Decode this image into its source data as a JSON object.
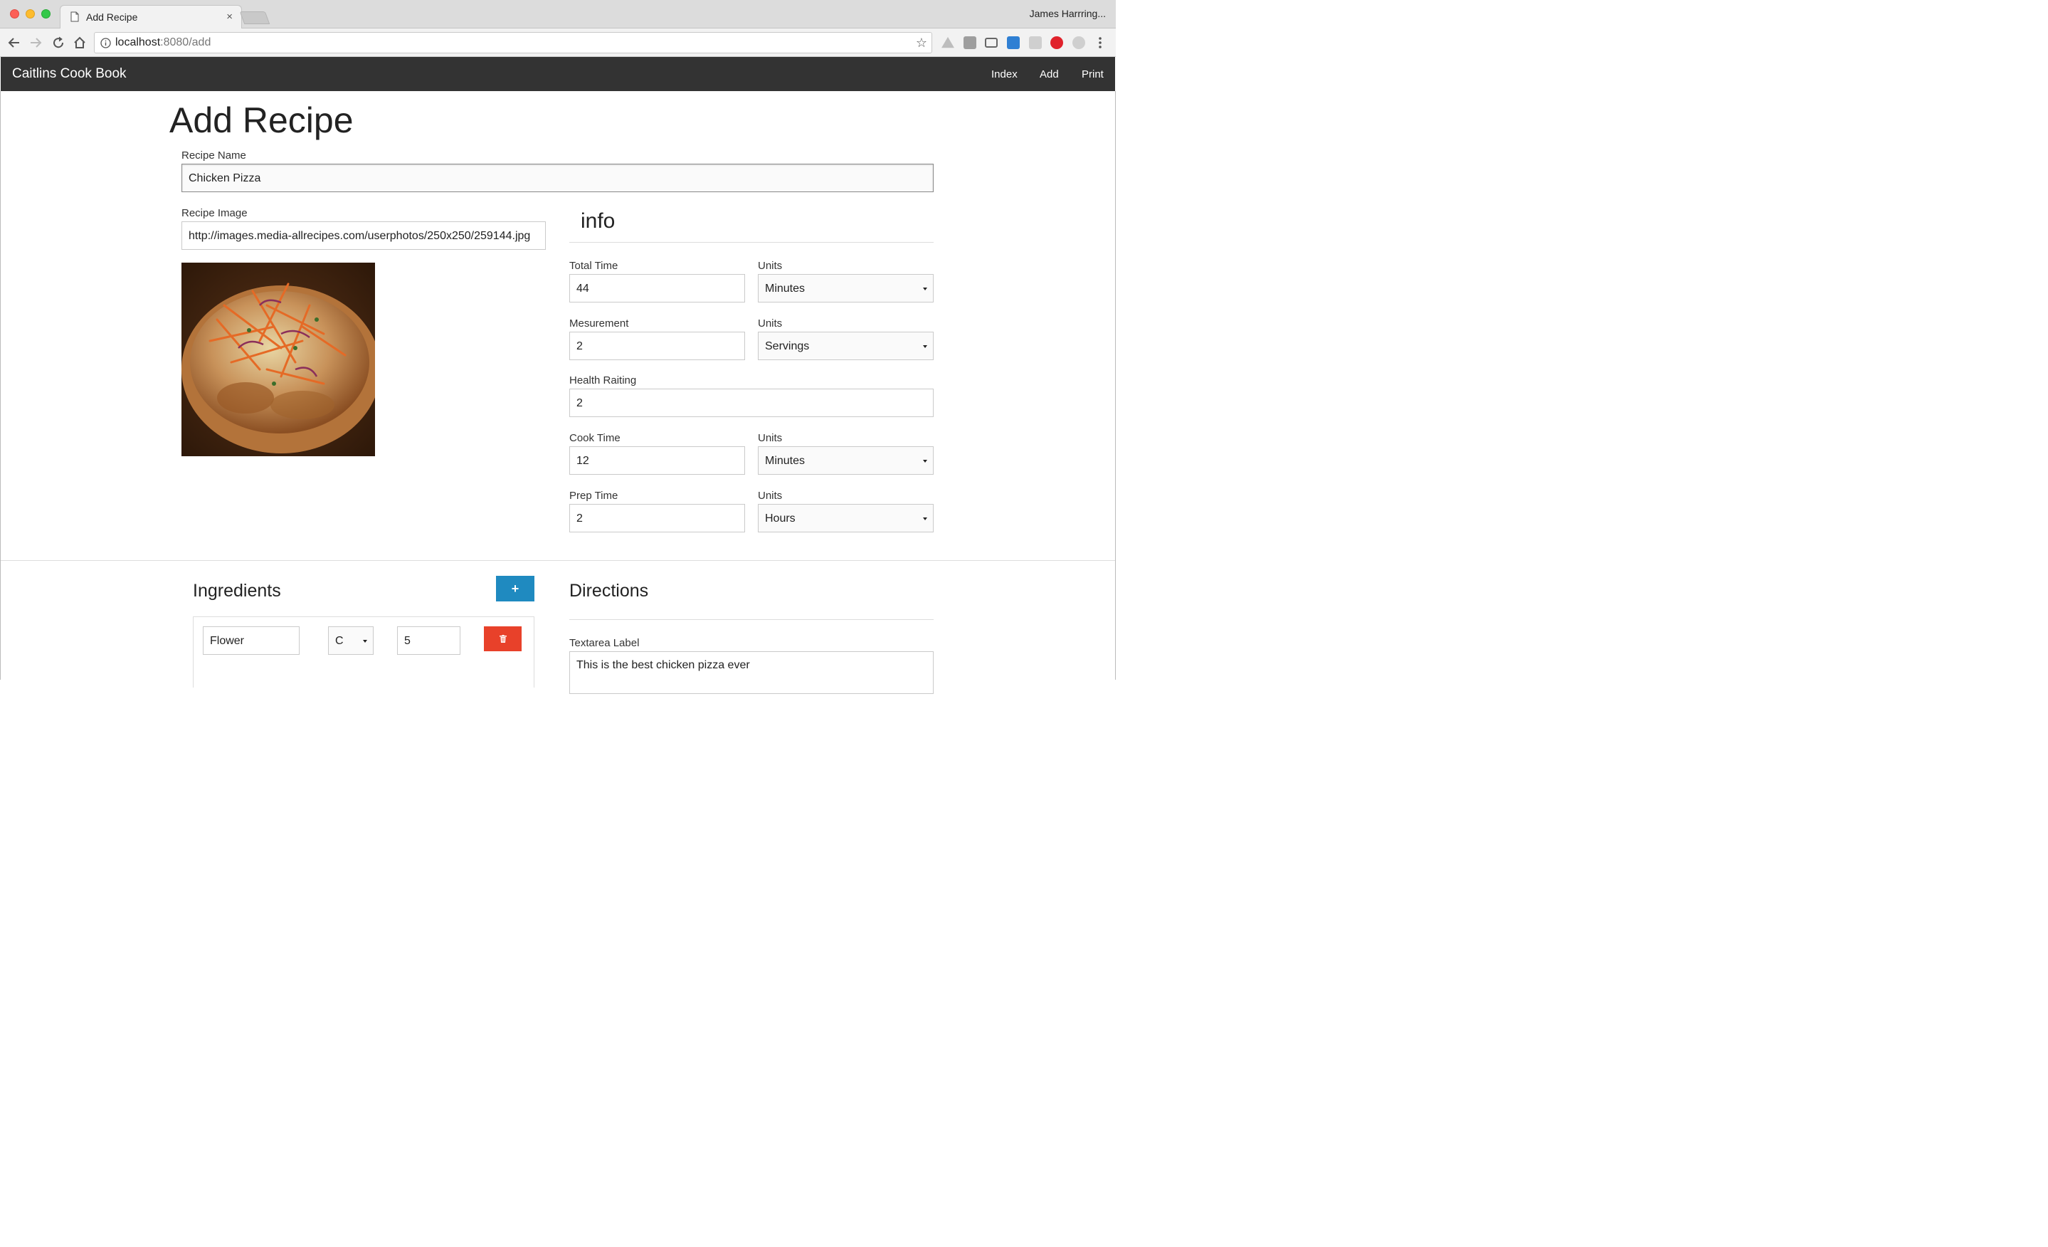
{
  "browser": {
    "tab_title": "Add Recipe",
    "tab_close": "×",
    "profile_name": "James Harrring...",
    "url_host": "localhost",
    "url_path": ":8080/add"
  },
  "navbar": {
    "brand": "Caitlins Cook Book",
    "links": [
      "Index",
      "Add",
      "Print"
    ]
  },
  "page": {
    "title": "Add Recipe"
  },
  "form": {
    "recipe_name_label": "Recipe Name",
    "recipe_name_value": "Chicken Pizza",
    "recipe_image_label": "Recipe Image",
    "recipe_image_value": "http://images.media-allrecipes.com/userphotos/250x250/259144.jpg"
  },
  "info": {
    "heading": "info",
    "units_label": "Units",
    "total_time_label": "Total Time",
    "total_time_value": "44",
    "total_time_units": "Minutes",
    "measurement_label": "Mesurement",
    "measurement_value": "2",
    "measurement_units": "Servings",
    "health_rating_label": "Health Raiting",
    "health_rating_value": "2",
    "cook_time_label": "Cook Time",
    "cook_time_value": "12",
    "cook_time_units": "Minutes",
    "prep_time_label": "Prep Time",
    "prep_time_value": "2",
    "prep_time_units": "Hours"
  },
  "ingredients": {
    "heading": "Ingredients",
    "add_button": "+",
    "rows": [
      {
        "name": "Flower",
        "unit": "C",
        "amount": "5"
      }
    ]
  },
  "directions": {
    "heading": "Directions",
    "textarea_label": "Textarea Label",
    "textarea_value": "This is the best chicken pizza ever"
  },
  "colors": {
    "navbar_bg": "#333333",
    "add_button": "#1f8ac0",
    "delete_button": "#e8412a"
  }
}
